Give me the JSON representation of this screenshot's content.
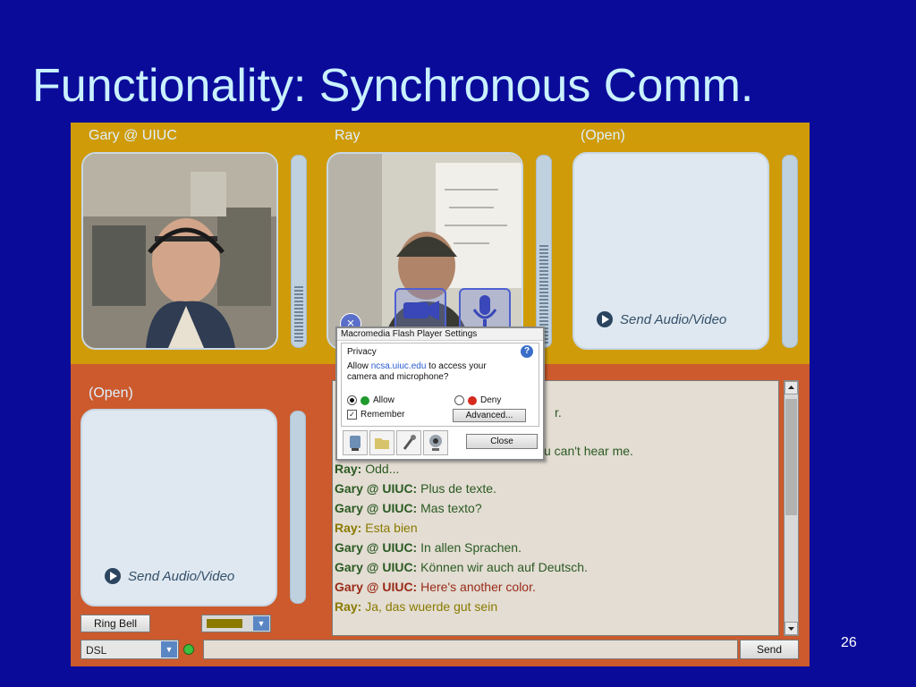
{
  "slide": {
    "title": "Functionality: Synchronous Comm.",
    "page_number": "26"
  },
  "colors": {
    "slide_background": "#0b0b9a",
    "top_band": "#cf9b08",
    "bottom_band": "#cc5a2c",
    "name_green": "#2b5a22",
    "name_olive": "#8a7a00",
    "name_red": "#9a2a18"
  },
  "video_slots": [
    {
      "label": "Gary @ UIUC",
      "state": "video"
    },
    {
      "label": "Ray",
      "state": "video"
    },
    {
      "label": "(Open)",
      "state": "open",
      "action": "Send Audio/Video"
    },
    {
      "label": "(Open)",
      "state": "open",
      "action": "Send Audio/Video"
    }
  ],
  "controls": {
    "ring_bell": "Ring Bell",
    "connection": "DSL",
    "send": "Send",
    "message_value": ""
  },
  "chat": {
    "partial_lines": [
      "r.",
      "u can't hear me."
    ],
    "messages": [
      {
        "name": "Ray:",
        "text": " Odd...",
        "color": "#2b5a22"
      },
      {
        "name": "Gary @ UIUC:",
        "text": " Plus de texte.",
        "color": "#2b5a22"
      },
      {
        "name": "Gary @ UIUC:",
        "text": " Mas texto?",
        "color": "#2b5a22"
      },
      {
        "name": "Ray:",
        "text": " Esta bien",
        "color": "#8a7a00"
      },
      {
        "name": "Gary @ UIUC:",
        "text": " In allen Sprachen.",
        "color": "#2b5a22"
      },
      {
        "name": "Gary @ UIUC:",
        "text": " Können wir auch auf Deutsch.",
        "color": "#2b5a22"
      },
      {
        "name": "Gary @ UIUC:",
        "text": " Here's another color.",
        "color": "#9a2a18"
      },
      {
        "name": "Ray:",
        "text": " Ja, das wuerde gut sein",
        "color": "#8a7a00"
      }
    ]
  },
  "flash_dialog": {
    "title": "Macromedia Flash Player Settings",
    "section": "Privacy",
    "prompt_prefix": "Allow ",
    "domain": "ncsa.uiuc.edu",
    "prompt_suffix": " to access your",
    "prompt_line2": "camera and microphone?",
    "allow_label": "Allow",
    "deny_label": "Deny",
    "remember_label": "Remember",
    "advanced_label": "Advanced...",
    "close_label": "Close",
    "help_glyph": "?",
    "close_glyph": "×"
  }
}
